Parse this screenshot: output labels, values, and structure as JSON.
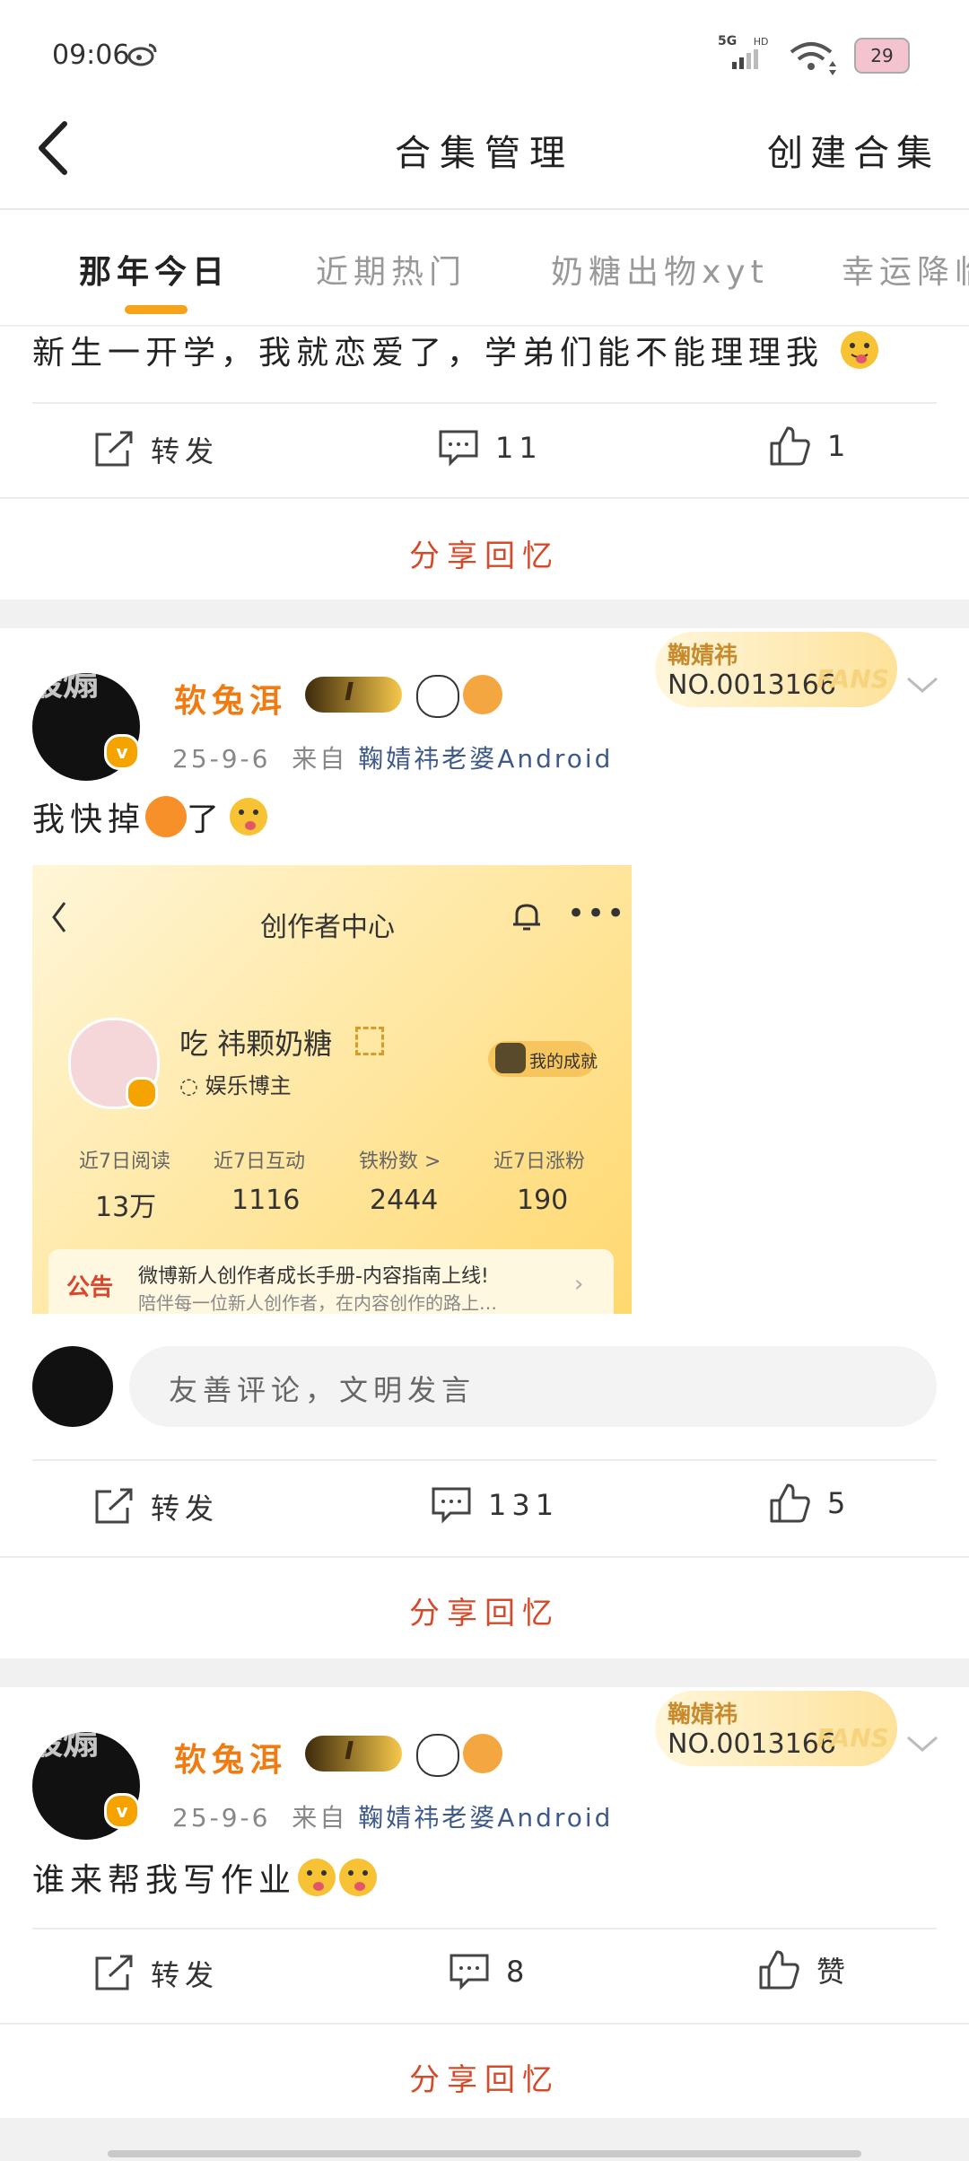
{
  "status_bar": {
    "time": "09:06",
    "network": "5G",
    "hd": "HD",
    "battery": "29"
  },
  "header": {
    "title": "合集管理",
    "create": "创建合集"
  },
  "tabs": [
    "那年今日",
    "近期热门",
    "奶糖出物xyt",
    "幸运降临"
  ],
  "colors": {
    "accent": "#f7a21b",
    "share": "#d54b2a",
    "username": "#f07b11",
    "source": "#3f5a8a"
  },
  "post0": {
    "text": "新生一开学，我就恋爱了，学弟们能不能理理我",
    "repost": "转发",
    "comments": "11",
    "likes": "1",
    "share": "分享回忆"
  },
  "post1": {
    "username": "软兔洱",
    "date": "25-9-6",
    "from": "来自",
    "source": "鞠婧祎老婆Android",
    "fans_name": "鞠婧祎",
    "fans_no": "NO.0013166",
    "fans_tag": "FANS",
    "vip_level": "I",
    "watermark": "最煽",
    "text": "我快掉",
    "text_suffix": "了",
    "screenshot": {
      "title": "创作者中心",
      "name": "吃 祎颗奶糖",
      "role": "娱乐博主",
      "achievement": "我的成就",
      "stats": [
        {
          "label": "近7日阅读",
          "value": "13万"
        },
        {
          "label": "近7日互动",
          "value": "1116"
        },
        {
          "label": "铁粉数 >",
          "value": "2444"
        },
        {
          "label": "近7日涨粉",
          "value": "190"
        }
      ],
      "notice_tag": "公告",
      "notice_title": "微博新人创作者成长手册-内容指南上线!",
      "notice_sub": "陪伴每一位新人创作者，在内容创作的路上…"
    },
    "comment_placeholder": "友善评论，文明发言",
    "repost": "转发",
    "comments": "131",
    "likes": "5",
    "share": "分享回忆"
  },
  "post2": {
    "username": "软兔洱",
    "date": "25-9-6",
    "from": "来自",
    "source": "鞠婧祎老婆Android",
    "fans_name": "鞠婧祎",
    "fans_no": "NO.0013166",
    "fans_tag": "FANS",
    "vip_level": "I",
    "watermark": "最煽",
    "text": "谁来帮我写作业",
    "repost": "转发",
    "comments": "8",
    "likes": "赞",
    "share": "分享回忆"
  }
}
